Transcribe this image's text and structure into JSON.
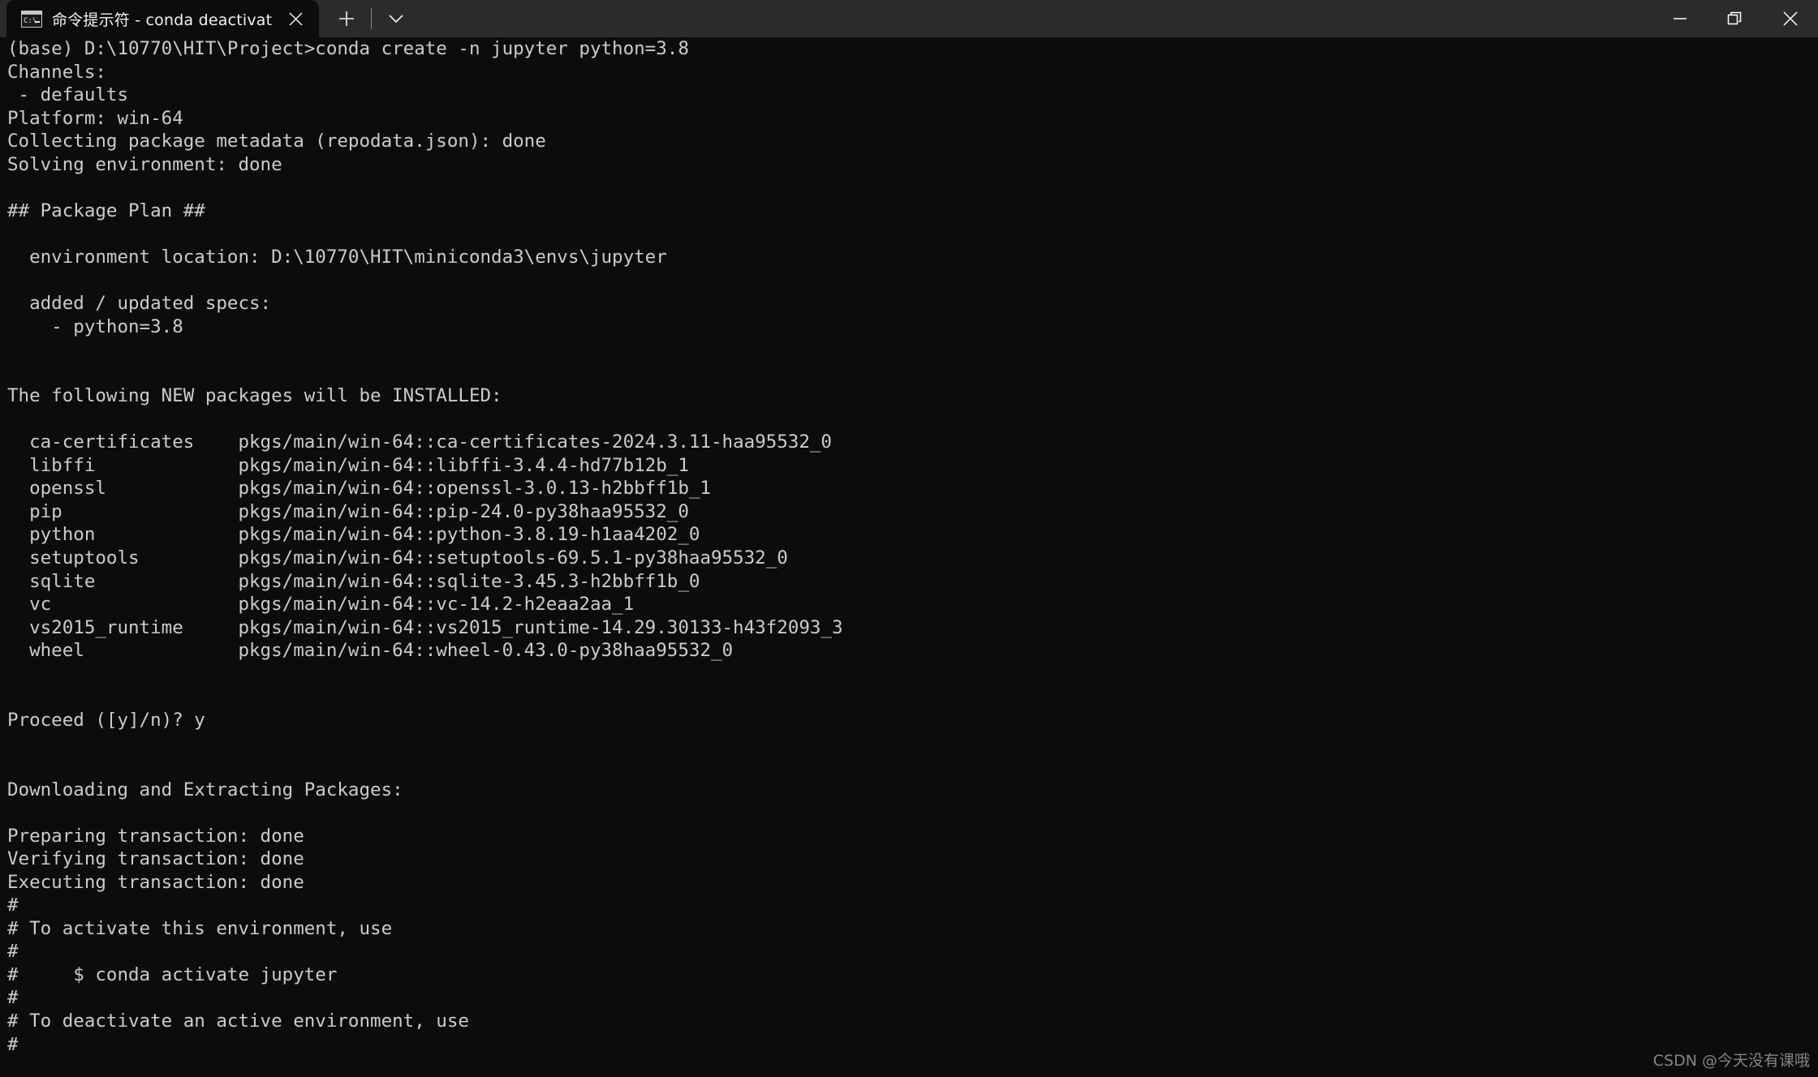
{
  "window": {
    "tab": {
      "icon": "console-icon",
      "title": "命令提示符 - conda  deactivat",
      "close_label": "✕"
    },
    "newtab_label": "+",
    "dropdown_label": "⌄",
    "controls": {
      "minimize": "–",
      "restore": "❐",
      "close": "✕"
    },
    "colors": {
      "titlebar_bg": "#2b2b2b",
      "terminal_bg": "#0c0c0c",
      "terminal_fg": "#ccccc7",
      "tab_active_bg": "#0c0c0c"
    }
  },
  "watermark": "CSDN @今天没有课哦",
  "terminal": {
    "lines": [
      "(base) D:\\10770\\HIT\\Project>conda create -n jupyter python=3.8",
      "Channels:",
      " - defaults",
      "Platform: win-64",
      "Collecting package metadata (repodata.json): done",
      "Solving environment: done",
      "",
      "## Package Plan ##",
      "",
      "  environment location: D:\\10770\\HIT\\miniconda3\\envs\\jupyter",
      "",
      "  added / updated specs:",
      "    - python=3.8",
      "",
      "",
      "The following NEW packages will be INSTALLED:",
      "",
      "  ca-certificates    pkgs/main/win-64::ca-certificates-2024.3.11-haa95532_0",
      "  libffi             pkgs/main/win-64::libffi-3.4.4-hd77b12b_1",
      "  openssl            pkgs/main/win-64::openssl-3.0.13-h2bbff1b_1",
      "  pip                pkgs/main/win-64::pip-24.0-py38haa95532_0",
      "  python             pkgs/main/win-64::python-3.8.19-h1aa4202_0",
      "  setuptools         pkgs/main/win-64::setuptools-69.5.1-py38haa95532_0",
      "  sqlite             pkgs/main/win-64::sqlite-3.45.3-h2bbff1b_0",
      "  vc                 pkgs/main/win-64::vc-14.2-h2eaa2aa_1",
      "  vs2015_runtime     pkgs/main/win-64::vs2015_runtime-14.29.30133-h43f2093_3",
      "  wheel              pkgs/main/win-64::wheel-0.43.0-py38haa95532_0",
      "",
      "",
      "Proceed ([y]/n)? y",
      "",
      "",
      "Downloading and Extracting Packages:",
      "",
      "Preparing transaction: done",
      "Verifying transaction: done",
      "Executing transaction: done",
      "#",
      "# To activate this environment, use",
      "#",
      "#     $ conda activate jupyter",
      "#",
      "# To deactivate an active environment, use",
      "#"
    ]
  }
}
